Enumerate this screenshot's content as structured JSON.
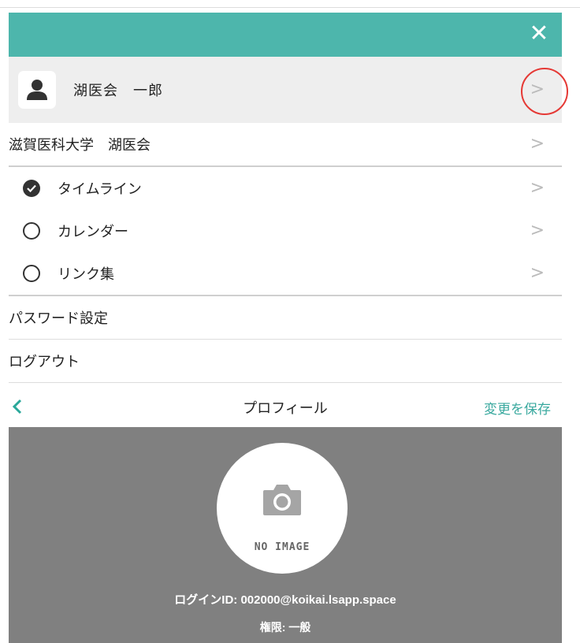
{
  "menu": {
    "close_icon": "close-icon",
    "user": {
      "name": "湖医会　一郎",
      "icon": "person-icon"
    },
    "group": {
      "label": "滋賀医科大学　湖医会"
    },
    "views": [
      {
        "label": "タイムライン",
        "selected": true
      },
      {
        "label": "カレンダー",
        "selected": false
      },
      {
        "label": "リンク集",
        "selected": false
      }
    ],
    "password": {
      "label": "パスワード設定"
    },
    "logout": {
      "label": "ログアウト"
    },
    "chevron": ">"
  },
  "profile": {
    "title": "プロフィール",
    "save_label": "変更を保存",
    "no_image": "NO IMAGE",
    "login_id": "ログインID: 002000@koikai.lsapp.space",
    "role": "権限: 一般"
  },
  "colors": {
    "accent": "#4db6ac",
    "link": "#3aa99f",
    "annotation": "#e53935",
    "profile_bg": "#808080"
  }
}
